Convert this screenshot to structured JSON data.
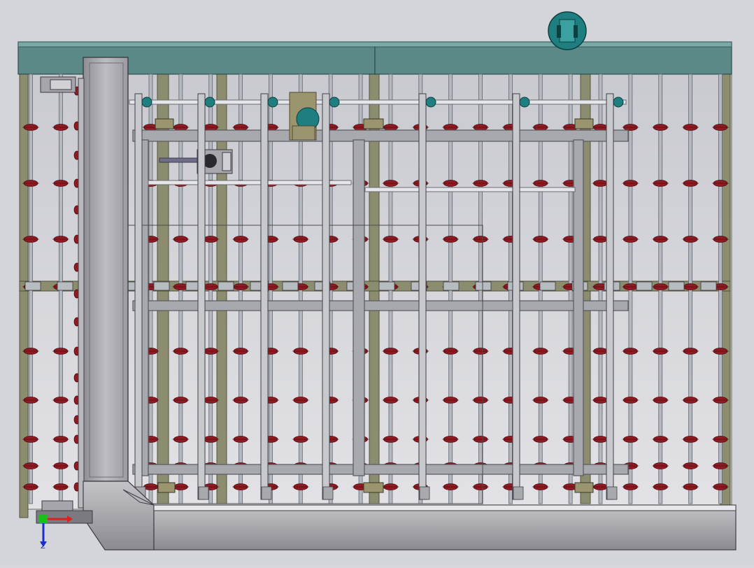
{
  "view": {
    "background": [
      "#bfc1c8",
      "#e4e4e8"
    ],
    "frame_color": "#8c8c6e",
    "rail_color": "#b4b8c0",
    "roller_color": "#8e1a22",
    "panel_teal": "#5a8a88",
    "motor_teal": "#1f7f80",
    "rail_count": 24,
    "roller_rows": 9
  },
  "triad": {
    "z_label": "Z",
    "x_color": "#e02020",
    "y_color": "#18c018",
    "z_color": "#1a2fd0"
  }
}
